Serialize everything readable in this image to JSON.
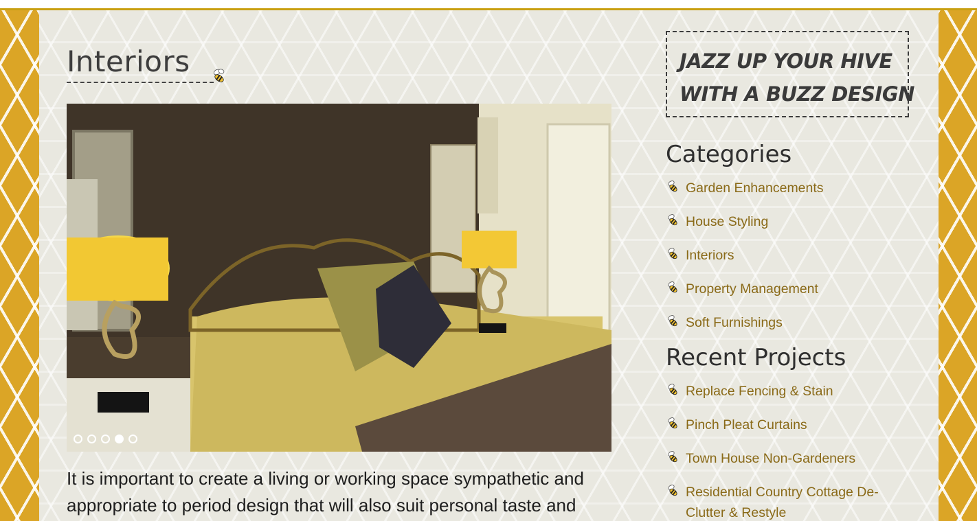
{
  "page": {
    "title": "Interiors",
    "intro": "It is important to create a living or working space sympathetic and appropriate to period design that will also suit personal taste and"
  },
  "slider": {
    "image_alt": "bedroom-interior-photo",
    "slide_count": 5,
    "active_slide": 4
  },
  "sidebar": {
    "promo": {
      "line1": "JAZZ UP YOUR HIVE",
      "line2": "WITH A BUZZ DESIGN"
    },
    "categories": {
      "title": "Categories",
      "items": [
        {
          "label": "Garden Enhancements"
        },
        {
          "label": "House Styling"
        },
        {
          "label": "Interiors"
        },
        {
          "label": "Property Management"
        },
        {
          "label": "Soft Furnishings"
        }
      ]
    },
    "recent": {
      "title": "Recent Projects",
      "items": [
        {
          "label": "Replace Fencing & Stain"
        },
        {
          "label": "Pinch Pleat Curtains"
        },
        {
          "label": "Town House Non-Gardeners"
        },
        {
          "label": "Residential Country Cottage De-Clutter & Restyle"
        }
      ]
    }
  },
  "colors": {
    "honeycomb": "#dba526",
    "panel": "#e9e8e0",
    "link": "#8a6a18",
    "heading": "#3d3d3d"
  },
  "icons": {
    "bullet": "bee-icon"
  }
}
